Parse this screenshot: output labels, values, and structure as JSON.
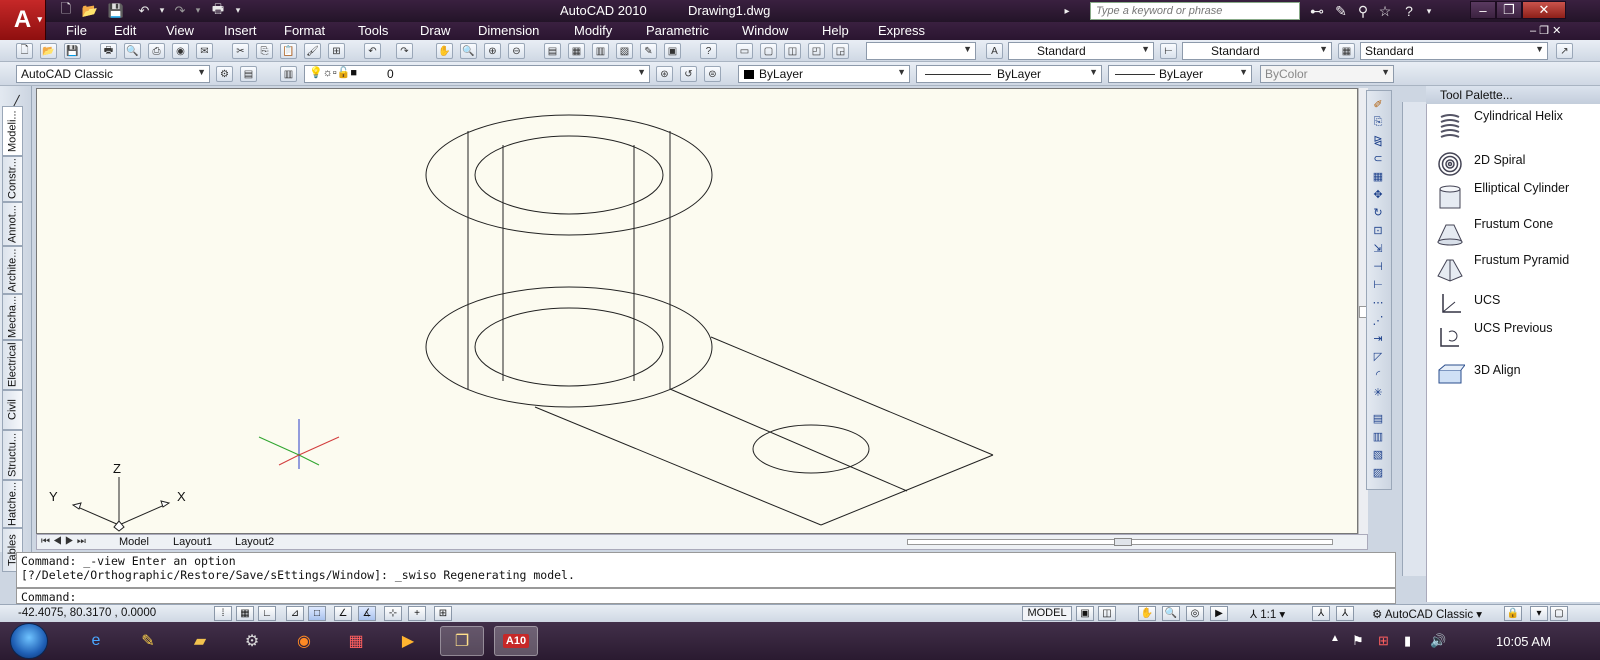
{
  "window": {
    "app_title": "AutoCAD 2010",
    "file_name": "Drawing1.dwg",
    "logo_text": "A",
    "search_placeholder": "Type a keyword or phrase"
  },
  "menu": [
    "File",
    "Edit",
    "View",
    "Insert",
    "Format",
    "Tools",
    "Draw",
    "Dimension",
    "Modify",
    "Parametric",
    "Window",
    "Help",
    "Express"
  ],
  "styles_toolbar": {
    "text_style": "Standard",
    "dim_style": "Standard",
    "table_style": "Standard"
  },
  "workspace_toolbar": {
    "workspace": "AutoCAD Classic",
    "layer": "0",
    "color": "ByLayer",
    "linetype": "ByLayer",
    "lineweight": "ByLayer",
    "plot_style": "ByColor"
  },
  "ucs_icon": {
    "x_label": "X",
    "y_label": "Y",
    "z_label": "Z"
  },
  "layout_tabs": [
    "Model",
    "Layout1",
    "Layout2"
  ],
  "palette": {
    "title": "Tool Palette...",
    "tabs": [
      "Modeli...",
      "Constr...",
      "Annot...",
      "Archite...",
      "Mecha...",
      "Electrical",
      "Civil",
      "Structu...",
      "Hatche...",
      "Tables"
    ],
    "items": [
      {
        "label": "Cylindrical Helix",
        "icon": "helix-icon"
      },
      {
        "label": "2D Spiral",
        "icon": "spiral-icon"
      },
      {
        "label": "Elliptical Cylinder",
        "icon": "elliptical-cylinder-icon"
      },
      {
        "label": "Frustum Cone",
        "icon": "frustum-cone-icon"
      },
      {
        "label": "Frustum Pyramid",
        "icon": "frustum-pyramid-icon"
      },
      {
        "label": "UCS",
        "icon": "ucs-icon"
      },
      {
        "label": "UCS Previous",
        "icon": "ucs-previous-icon"
      },
      {
        "label": "3D Align",
        "icon": "3d-align-icon"
      }
    ]
  },
  "command": {
    "history_line1": "Command: _-view Enter an option",
    "history_line2": "[?/Delete/Orthographic/Restore/Save/sEttings/Window]: _swiso Regenerating model.",
    "prompt": "Command:"
  },
  "status": {
    "coords": "-42.4075, 80.3170 , 0.0000",
    "space": "MODEL",
    "scale": "1:1",
    "workspace": "AutoCAD Classic"
  },
  "taskbar": {
    "clock": "10:05 AM",
    "active_app_label": "A10"
  }
}
